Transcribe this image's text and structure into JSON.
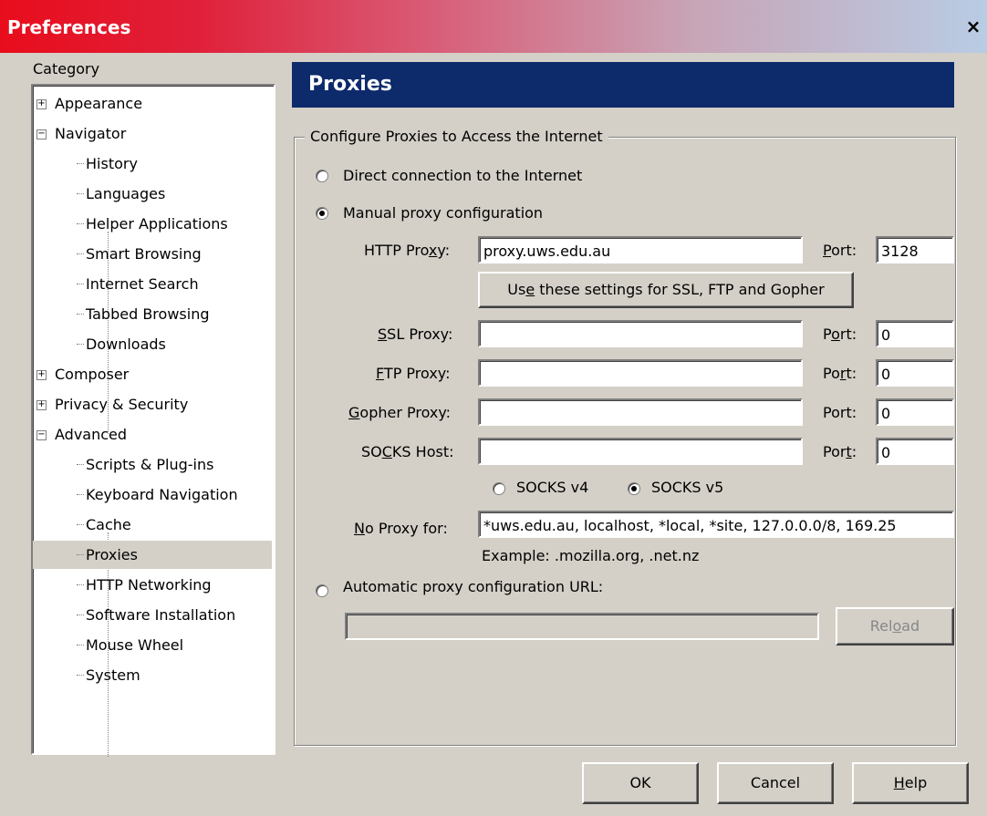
{
  "window": {
    "title": "Preferences",
    "close_label": "×"
  },
  "category_label": "Category",
  "tree": [
    {
      "label": "Appearance",
      "expander": "+"
    },
    {
      "label": "Navigator",
      "expander": "−"
    },
    {
      "label": "History"
    },
    {
      "label": "Languages"
    },
    {
      "label": "Helper Applications"
    },
    {
      "label": "Smart Browsing"
    },
    {
      "label": "Internet Search"
    },
    {
      "label": "Tabbed Browsing"
    },
    {
      "label": "Downloads"
    },
    {
      "label": "Composer",
      "expander": "+"
    },
    {
      "label": "Privacy & Security",
      "expander": "+"
    },
    {
      "label": "Advanced",
      "expander": "−"
    },
    {
      "label": "Scripts & Plug-ins"
    },
    {
      "label": "Keyboard Navigation"
    },
    {
      "label": "Cache"
    },
    {
      "label": "Proxies",
      "selected": true
    },
    {
      "label": "HTTP Networking"
    },
    {
      "label": "Software Installation"
    },
    {
      "label": "Mouse Wheel"
    },
    {
      "label": "System"
    }
  ],
  "panel": {
    "title": "Proxies",
    "group_title": "Configure Proxies to Access the Internet",
    "direct_label": "Direct connection to the Internet",
    "manual_label": "Manual proxy configuration",
    "http_label": "HTTP Proxy:",
    "http_value": "proxy.uws.edu.au",
    "port_label": "Port:",
    "http_port": "3128",
    "use_same_button": "Use these settings for SSL, FTP and Gopher",
    "ssl_label": "SSL Proxy:",
    "ssl_value": "",
    "ssl_port": "0",
    "ftp_label": "FTP Proxy:",
    "ftp_value": "",
    "ftp_port": "0",
    "gopher_label": "Gopher Proxy:",
    "gopher_value": "",
    "gopher_port": "0",
    "socks_label": "SOCKS Host:",
    "socks_value": "",
    "socks_port": "0",
    "socks_v4": "SOCKS v4",
    "socks_v5": "SOCKS v5",
    "noproxy_label": "No Proxy for:",
    "noproxy_value": "*uws.edu.au, localhost, *local, *site, 127.0.0.0/8, 169.25",
    "example": "Example: .mozilla.org, .net.nz",
    "auto_label": "Automatic proxy configuration URL:",
    "auto_value": "",
    "reload_button": "Reload"
  },
  "footer": {
    "ok": "OK",
    "cancel": "Cancel",
    "help": "Help"
  }
}
